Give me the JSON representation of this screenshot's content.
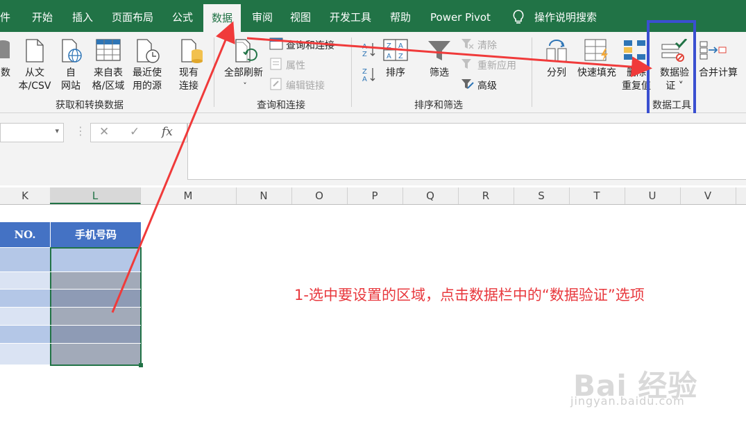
{
  "tabs": [
    "件",
    "开始",
    "插入",
    "页面布局",
    "公式",
    "数据",
    "审阅",
    "视图",
    "开发工具",
    "帮助",
    "Power Pivot",
    "操作说明搜索"
  ],
  "active_tab": "数据",
  "groups": {
    "get_transform": {
      "label": "获取和转换数据",
      "buttons": [
        "数",
        "从文\n本/CSV",
        "自\n网站",
        "来自表\n格/区域",
        "最近使\n用的源",
        "现有\n连接"
      ]
    },
    "queries": {
      "label": "查询和连接",
      "refresh_all": "全部刷新",
      "items": [
        "查询和连接",
        "属性",
        "编辑链接"
      ]
    },
    "sort_filter": {
      "label": "排序和筛选",
      "sort": "排序",
      "filter": "筛选",
      "items": [
        "清除",
        "重新应用",
        "高级"
      ]
    },
    "data_tools": {
      "label": "数据工具",
      "buttons": [
        "分列",
        "快速填充",
        "删除\n重复值",
        "数据验\n证 ˅",
        "合并计算"
      ]
    }
  },
  "formula_bar": {
    "cancel": "✕",
    "enter": "✓",
    "fx": "fx"
  },
  "columns": [
    "K",
    "L",
    "M",
    "N",
    "O",
    "P",
    "Q",
    "R",
    "S",
    "T",
    "U",
    "V"
  ],
  "table": {
    "headers": [
      "NO.",
      "手机号码"
    ]
  },
  "annotation": "1-选中要设置的区域，点击数据栏中的“数据验证”选项",
  "watermark": {
    "brand": "Bai 经验",
    "url": "jingyan.baidu.com"
  },
  "colors": {
    "excel_green": "#217346",
    "annotation_red": "#e8383d",
    "highlight_box": "#3a4fd0",
    "table_header": "#4472c4"
  }
}
